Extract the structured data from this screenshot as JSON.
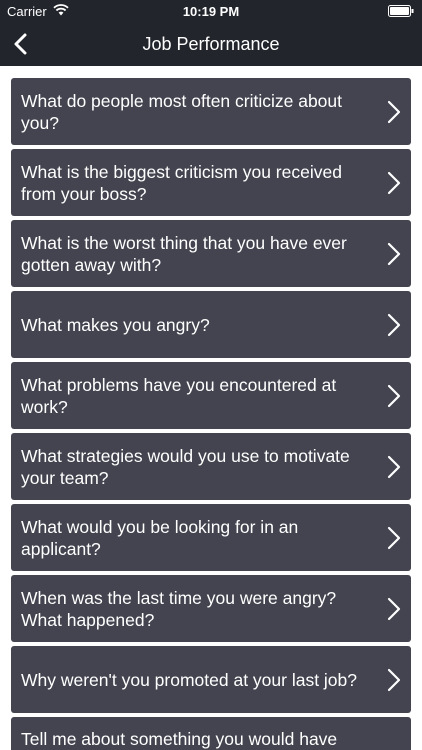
{
  "status": {
    "carrier": "Carrier",
    "time": "10:19 PM"
  },
  "nav": {
    "title": "Job Performance",
    "back_icon": "chevron-left-icon"
  },
  "colors": {
    "bar": "#22252c",
    "row": "#43444f",
    "text": "#ffffff"
  },
  "questions": [
    "What do people most often criticize about you?",
    "What is the biggest criticism you received from your boss?",
    "What is the worst thing that you have ever gotten away with?",
    "What makes you angry?",
    "What problems have you encountered at work?",
    "What strategies would you use to motivate your team?",
    "What would you be looking for in an applicant?",
    "When was the last time you were angry? What happened?",
    "Why weren't you promoted at your last job?",
    "Tell me about something you would have"
  ]
}
